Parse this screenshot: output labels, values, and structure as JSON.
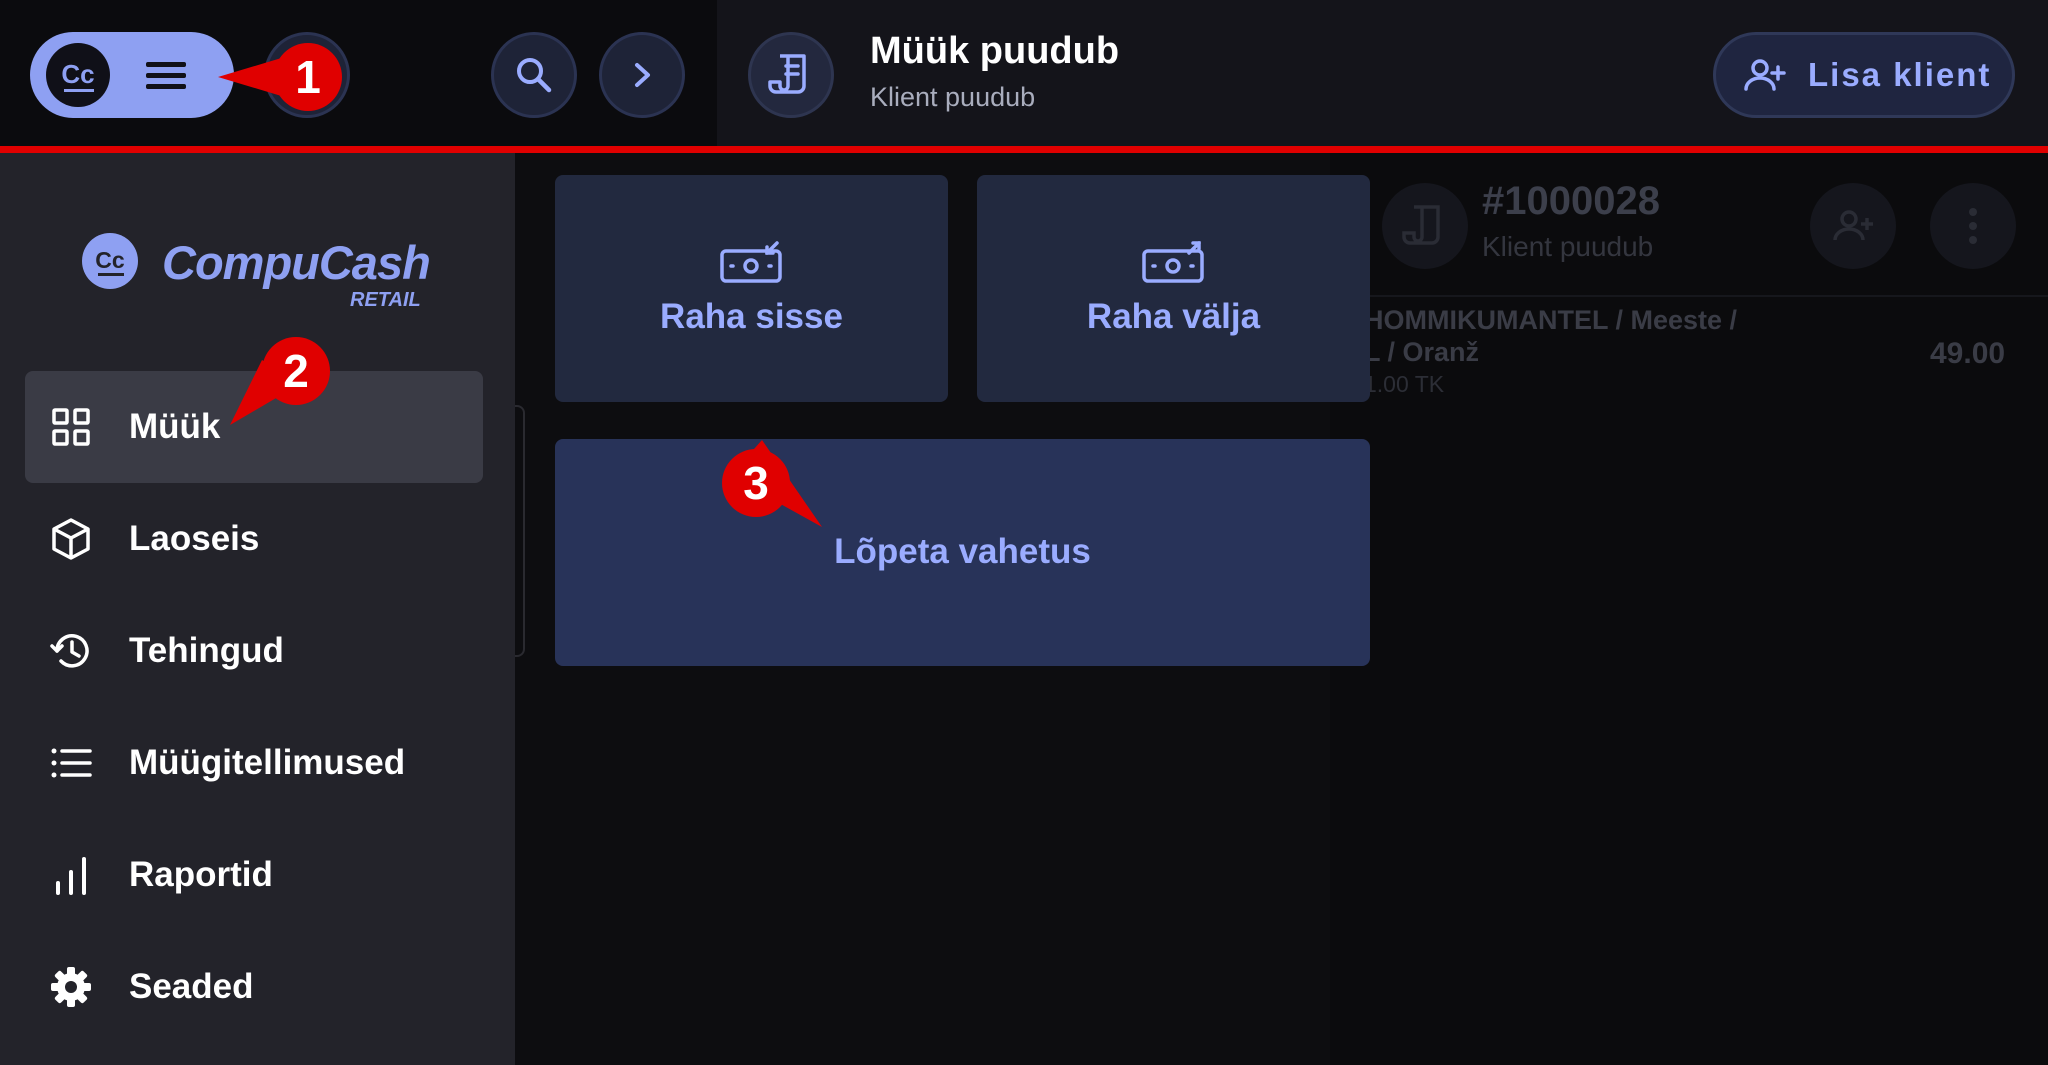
{
  "topbar": {
    "sale_title": "Müük puudub",
    "sale_subtitle": "Klient puudub",
    "add_client_label": "Lisa klient"
  },
  "sidebar": {
    "brand_name": "CompuCash",
    "brand_tagline": "RETAIL",
    "items": [
      {
        "label": "Müük",
        "icon": "grid-icon",
        "active": true
      },
      {
        "label": "Laoseis",
        "icon": "box-icon",
        "active": false
      },
      {
        "label": "Tehingud",
        "icon": "history-icon",
        "active": false
      },
      {
        "label": "Müügitellimused",
        "icon": "list-icon",
        "active": false
      },
      {
        "label": "Raportid",
        "icon": "bar-chart-icon",
        "active": false
      },
      {
        "label": "Seaded",
        "icon": "gear-icon",
        "active": false
      }
    ]
  },
  "main": {
    "tiles": [
      {
        "label": "Raha sisse",
        "icon": "cash-in-icon"
      },
      {
        "label": "Raha välja",
        "icon": "cash-out-icon"
      },
      {
        "label": "Lõpeta vahetus"
      }
    ]
  },
  "order": {
    "number": "#1000028",
    "client": "Klient puudub",
    "item_line1": "HOMMIKUMANTEL / Meeste /",
    "item_line2": "L / Oranž",
    "item_qty": "1.00 TK",
    "item_price": "49.00"
  },
  "callouts": [
    "1",
    "2",
    "3"
  ],
  "colors": {
    "accent": "#8ea0f2",
    "link": "#9aacff",
    "annotation": "#e00000",
    "sidebar_bg": "#23232a",
    "tile_bg": "#22293f"
  }
}
